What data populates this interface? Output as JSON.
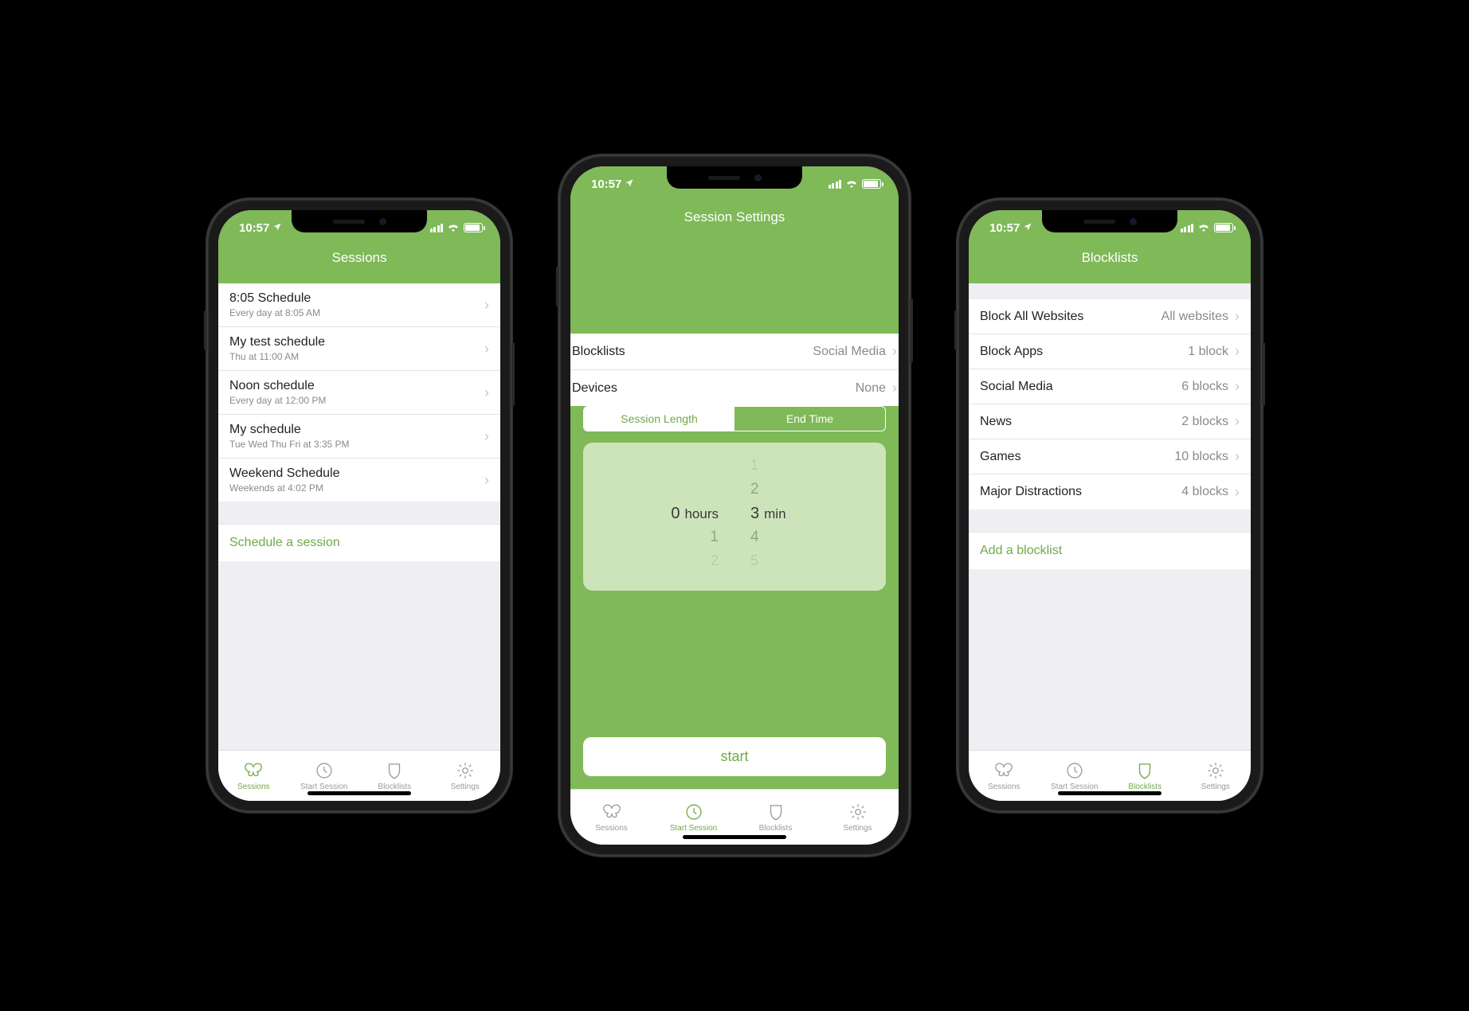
{
  "status": {
    "time": "10:57"
  },
  "tabs": {
    "sessions": "Sessions",
    "start": "Start Session",
    "blocklists": "Blocklists",
    "settings": "Settings"
  },
  "phone1": {
    "title": "Sessions",
    "items": [
      {
        "title": "8:05 Schedule",
        "sub": "Every day at 8:05 AM"
      },
      {
        "title": "My test schedule",
        "sub": "Thu at 11:00 AM"
      },
      {
        "title": "Noon schedule",
        "sub": "Every day at 12:00 PM"
      },
      {
        "title": "My schedule",
        "sub": "Tue Wed Thu Fri at 3:35 PM"
      },
      {
        "title": "Weekend Schedule",
        "sub": "Weekends at 4:02 PM"
      }
    ],
    "action": "Schedule a session"
  },
  "phone2": {
    "title": "Session Settings",
    "rows": [
      {
        "label": "Blocklists",
        "value": "Social Media"
      },
      {
        "label": "Devices",
        "value": "None"
      }
    ],
    "seg": {
      "a": "Session Length",
      "b": "End Time"
    },
    "picker": {
      "hours": {
        "value": "0",
        "unit": "hours"
      },
      "mins": {
        "value": "3",
        "unit": "min",
        "above2": "1",
        "above1": "2",
        "below1": "4",
        "below2": "5"
      },
      "hoursBelow1": "1",
      "hoursBelow2": "2"
    },
    "start": "start"
  },
  "phone3": {
    "title": "Blocklists",
    "items": [
      {
        "title": "Block All Websites",
        "value": "All websites"
      },
      {
        "title": "Block Apps",
        "value": "1 block"
      },
      {
        "title": "Social Media",
        "value": "6 blocks"
      },
      {
        "title": "News",
        "value": "2 blocks"
      },
      {
        "title": "Games",
        "value": "10 blocks"
      },
      {
        "title": "Major Distractions",
        "value": "4 blocks"
      }
    ],
    "action": "Add a blocklist"
  }
}
